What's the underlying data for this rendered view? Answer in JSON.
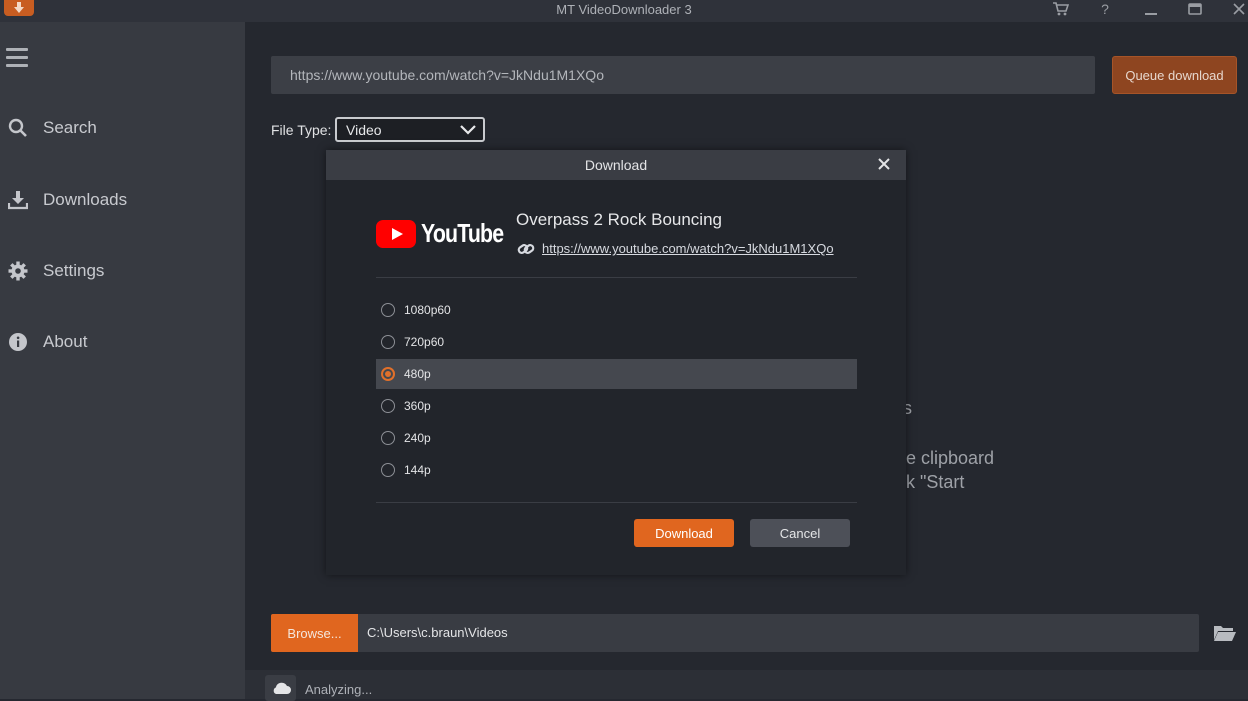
{
  "window": {
    "title": "MT VideoDownloader 3"
  },
  "titlebar_icons": [
    "cart-icon",
    "help-icon",
    "minimize-icon",
    "restore-icon",
    "close-icon"
  ],
  "sidebar": {
    "items": [
      {
        "label": "Search",
        "icon": "search-icon"
      },
      {
        "label": "Downloads",
        "icon": "download-icon"
      },
      {
        "label": "Settings",
        "icon": "gear-icon"
      },
      {
        "label": "About",
        "icon": "info-icon"
      }
    ]
  },
  "url_bar": {
    "value": "https://www.youtube.com/watch?v=JkNdu1M1XQo",
    "queue_button": "Queue download"
  },
  "file_type": {
    "label": "File Type:",
    "selected": "Video"
  },
  "background_text": {
    "fragment_1": "s",
    "fragment_2": "e clipboard",
    "fragment_3": "k \"Start"
  },
  "dialog": {
    "title": "Download",
    "source": "YouTube",
    "video_title": "Overpass 2 Rock Bouncing",
    "video_url": "https://www.youtube.com/watch?v=JkNdu1M1XQo",
    "options": [
      {
        "label": "1080p60",
        "selected": false
      },
      {
        "label": "720p60",
        "selected": false
      },
      {
        "label": "480p",
        "selected": true
      },
      {
        "label": "360p",
        "selected": false
      },
      {
        "label": "240p",
        "selected": false
      },
      {
        "label": "144p",
        "selected": false
      }
    ],
    "download_button": "Download",
    "cancel_button": "Cancel"
  },
  "browse": {
    "button": "Browse...",
    "path": "C:\\Users\\c.braun\\Videos"
  },
  "status": {
    "text": "Analyzing..."
  },
  "colors": {
    "accent": "#e0661f",
    "sidebar": "#373a41",
    "background": "#252830",
    "youtube_red": "#ff0000"
  }
}
